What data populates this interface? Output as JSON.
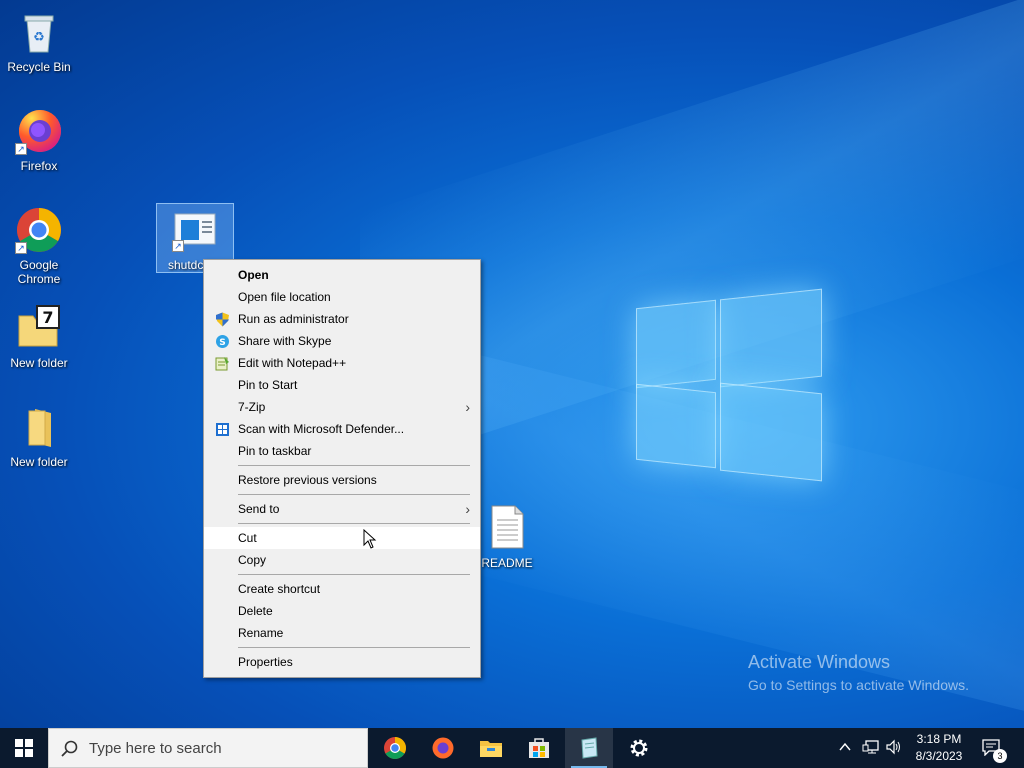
{
  "desktop": {
    "icons": [
      {
        "label": "Recycle Bin"
      },
      {
        "label": "Firefox"
      },
      {
        "label": "Google\nChrome"
      },
      {
        "label": "New folder"
      },
      {
        "label": "New folder"
      },
      {
        "label": "shutdc"
      },
      {
        "label": "README"
      }
    ]
  },
  "context_menu": {
    "items": [
      {
        "label": "Open"
      },
      {
        "label": "Open file location"
      },
      {
        "label": "Run as administrator"
      },
      {
        "label": "Share with Skype"
      },
      {
        "label": "Edit with Notepad++"
      },
      {
        "label": "Pin to Start"
      },
      {
        "label": "7-Zip"
      },
      {
        "label": "Scan with Microsoft Defender..."
      },
      {
        "label": "Pin to taskbar"
      },
      {
        "label": "Restore previous versions"
      },
      {
        "label": "Send to"
      },
      {
        "label": "Cut"
      },
      {
        "label": "Copy"
      },
      {
        "label": "Create shortcut"
      },
      {
        "label": "Delete"
      },
      {
        "label": "Rename"
      },
      {
        "label": "Properties"
      }
    ]
  },
  "watermark": {
    "title": "Activate Windows",
    "subtitle": "Go to Settings to activate Windows."
  },
  "taskbar": {
    "search_placeholder": "Type here to search",
    "time": "3:18 PM",
    "date": "8/3/2023",
    "notification_count": "3",
    "pinned_apps": [
      "chrome-icon",
      "firefox-icon",
      "file-explorer-icon",
      "microsoft-store-icon",
      "notepad-icon",
      "settings-icon"
    ]
  },
  "colors": {
    "taskbar_bg": "#0b1a2e",
    "menu_bg": "#f0f0f0",
    "accent": "#0078d7"
  }
}
